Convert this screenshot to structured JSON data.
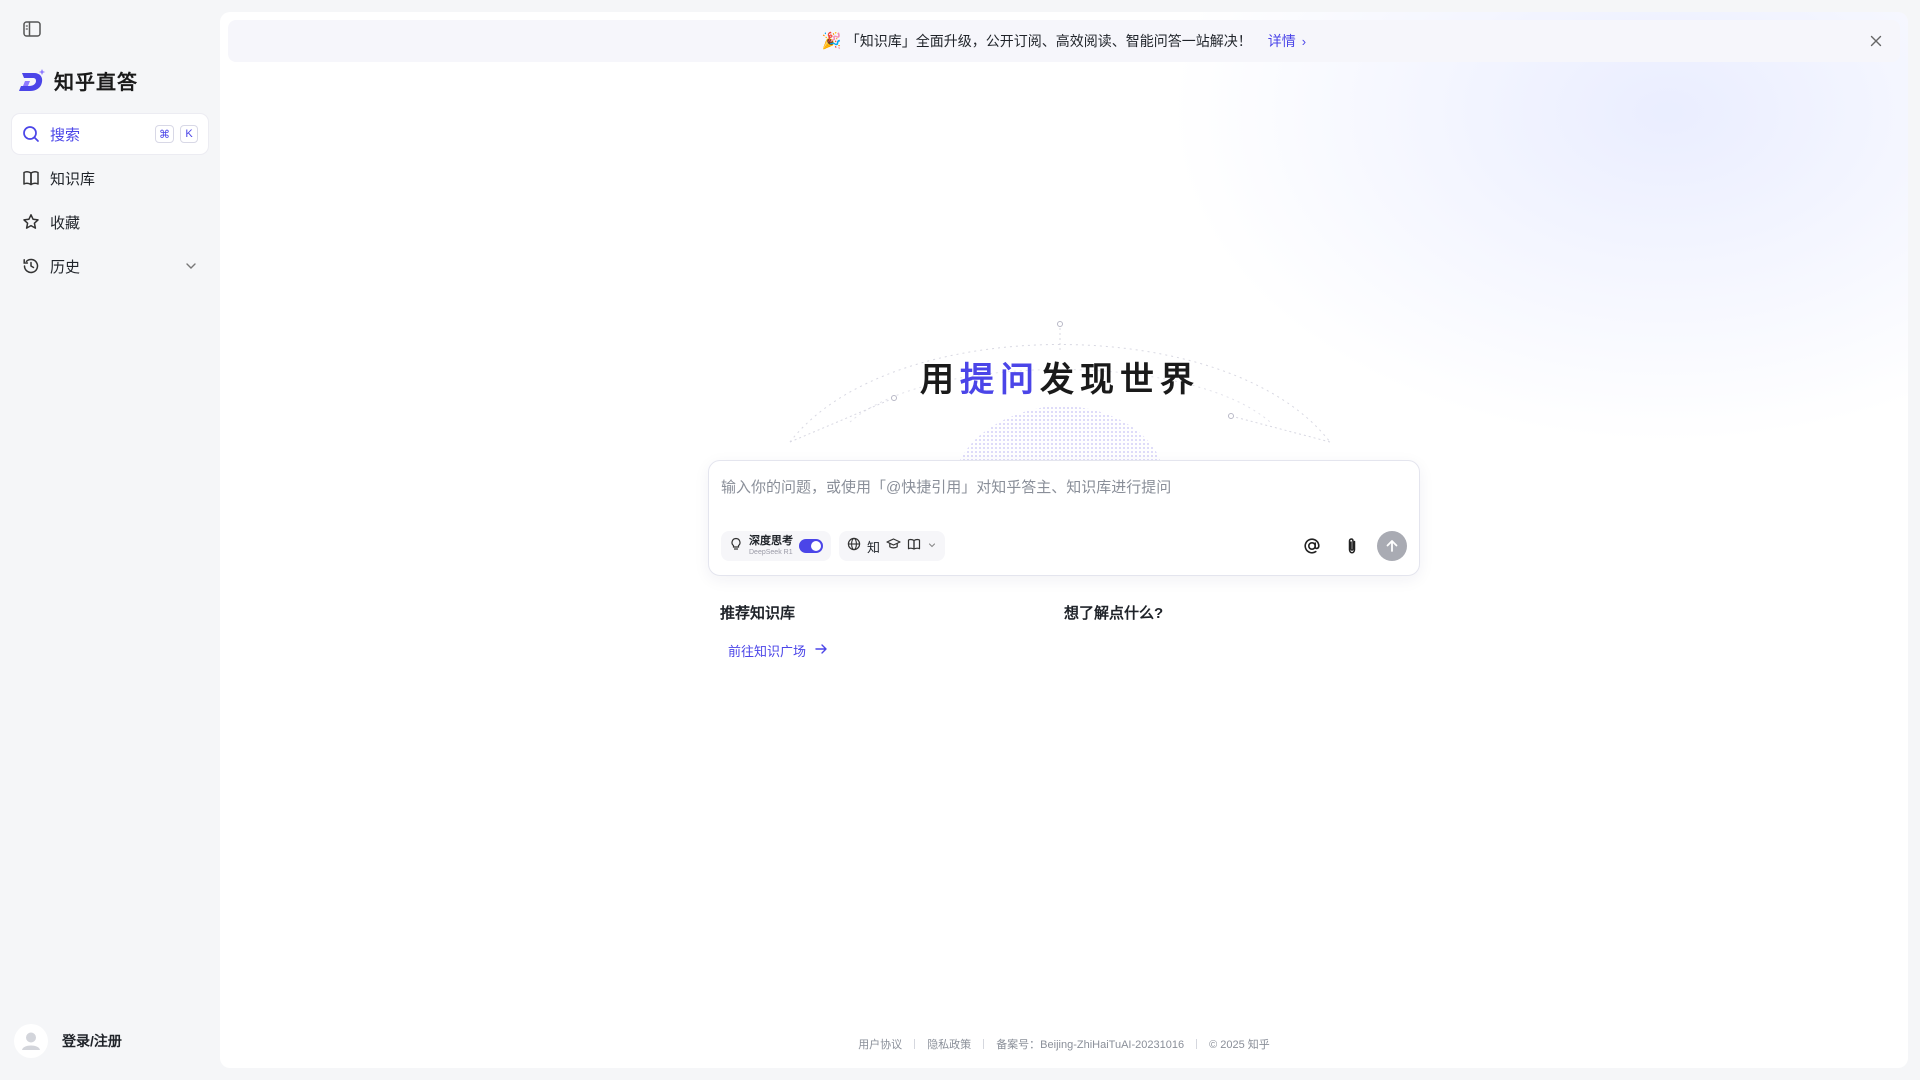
{
  "sidebar": {
    "brand_name": "知乎直答",
    "items": [
      {
        "label": "搜索",
        "icon": "search-icon",
        "shortcut": [
          "⌘",
          "K"
        ],
        "active": true
      },
      {
        "label": "知识库",
        "icon": "book-icon"
      },
      {
        "label": "收藏",
        "icon": "star-icon"
      },
      {
        "label": "历史",
        "icon": "clock-icon"
      }
    ],
    "login_label": "登录/注册"
  },
  "banner": {
    "emoji": "🎉",
    "text": "「知识库」全面升级，公开订阅、高效阅读、智能问答一站解决！",
    "link_label": "详情",
    "link_chevron": "›"
  },
  "hero": {
    "slogan_pre": "用",
    "slogan_highlight": "提问",
    "slogan_post": "发现世界"
  },
  "ask": {
    "placeholder": "输入你的问题，或使用「@快捷引用」对知乎答主、知识库进行提问",
    "deep_think_title": "深度思考",
    "deep_think_sub": "DeepSeek R1",
    "deep_think_on": true,
    "source_label": "知"
  },
  "sections": {
    "recommended_title": "推荐知识库",
    "goto_label": "前往知识广场",
    "curious_title": "想了解点什么?"
  },
  "footer": {
    "user_agreement": "用户协议",
    "privacy": "隐私政策",
    "icp": "备案号：Beijing-ZhiHaiTuAI-20231016",
    "copyright": "© 2025 知乎"
  },
  "colors": {
    "accent": "#4b45e8",
    "sidebar_bg": "#f5f6f8",
    "send_disabled": "#a9abb3"
  }
}
